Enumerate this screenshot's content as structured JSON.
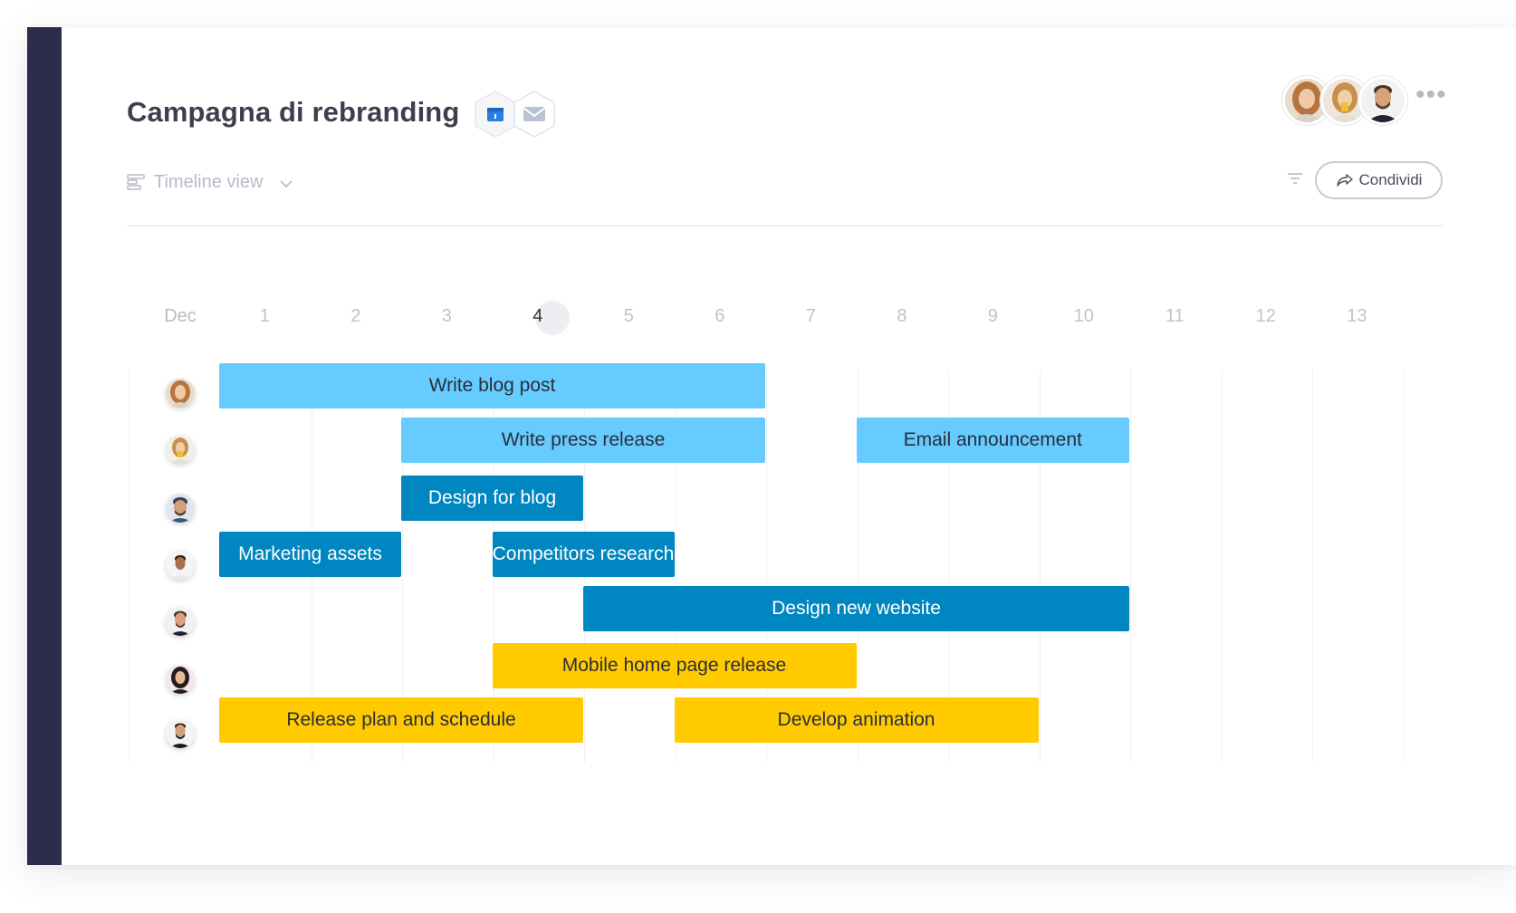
{
  "header": {
    "title": "Campagna di rebranding",
    "icons": [
      "calendar-icon",
      "mail-icon"
    ]
  },
  "toolbar": {
    "view_label": "Timeline view",
    "share_label": "Condividi"
  },
  "timeline": {
    "month": "Dec",
    "days": [
      "1",
      "2",
      "3",
      "4",
      "5",
      "6",
      "7",
      "8",
      "9",
      "10",
      "11",
      "12",
      "13"
    ],
    "today": "4"
  },
  "tasks": [
    {
      "label": "Write blog post",
      "start": 1,
      "end": 6,
      "row": 1,
      "color": "#66ccff"
    },
    {
      "label": "Write press release",
      "start": 3,
      "end": 6,
      "row": 2,
      "color": "#66ccff"
    },
    {
      "label": "Email announcement",
      "start": 8,
      "end": 10,
      "row": 2,
      "color": "#66ccff"
    },
    {
      "label": "Design for blog",
      "start": 3,
      "end": 4,
      "row": 3,
      "color": "#0086c0"
    },
    {
      "label": "Marketing assets",
      "start": 1,
      "end": 2,
      "row": 4,
      "color": "#0086c0"
    },
    {
      "label": "Competitors research",
      "start": 4,
      "end": 5,
      "row": 4,
      "color": "#0086c0"
    },
    {
      "label": "Design new website",
      "start": 5,
      "end": 10,
      "row": 5,
      "color": "#0086c0"
    },
    {
      "label": "Mobile home page release",
      "start": 4,
      "end": 7,
      "row": 6,
      "color": "#ffcb00"
    },
    {
      "label": "Release plan and schedule",
      "start": 1,
      "end": 4,
      "row": 7,
      "color": "#ffcb00"
    },
    {
      "label": "Develop animation",
      "start": 6,
      "end": 9,
      "row": 7,
      "color": "#ffcb00"
    }
  ]
}
